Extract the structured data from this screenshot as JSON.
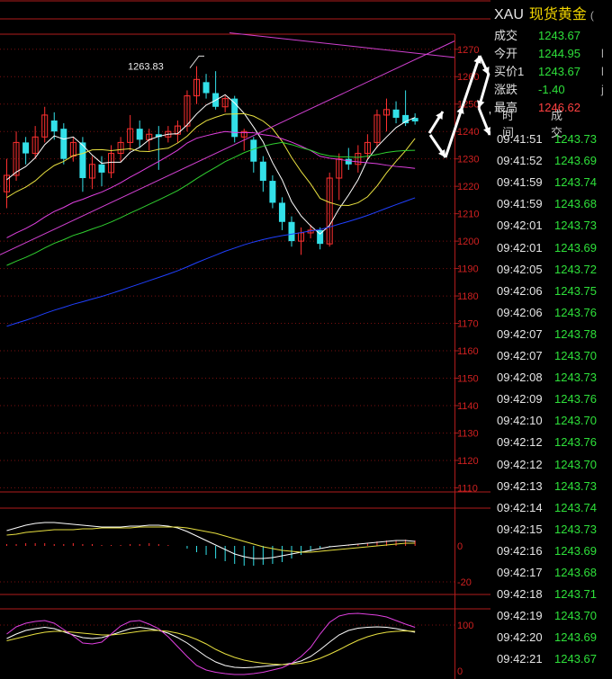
{
  "header": {
    "symbol": "XAU",
    "name": "现货黄金",
    "extra": "("
  },
  "quote": [
    {
      "label": "成交",
      "value": "1243.67",
      "color": "#2ee03a",
      "extra": ""
    },
    {
      "label": "今开",
      "value": "1244.95",
      "color": "#2ee03a",
      "extra": "l"
    },
    {
      "label": "买价1",
      "value": "1243.67",
      "color": "#2ee03a",
      "extra": "l"
    },
    {
      "label": "涨跌",
      "value": "-1.40",
      "color": "#2ee03a",
      "extra": "j"
    },
    {
      "label": "最高",
      "value": "1246.62",
      "color": "#ff4040",
      "extra": ""
    }
  ],
  "ticks_header": {
    "time": "时间",
    "trade": "成交"
  },
  "ticks": [
    {
      "time": "09:41:51",
      "price": "1243.73"
    },
    {
      "time": "09:41:52",
      "price": "1243.69"
    },
    {
      "time": "09:41:59",
      "price": "1243.74"
    },
    {
      "time": "09:41:59",
      "price": "1243.68"
    },
    {
      "time": "09:42:01",
      "price": "1243.73"
    },
    {
      "time": "09:42:01",
      "price": "1243.69"
    },
    {
      "time": "09:42:05",
      "price": "1243.72"
    },
    {
      "time": "09:42:06",
      "price": "1243.75"
    },
    {
      "time": "09:42:06",
      "price": "1243.76"
    },
    {
      "time": "09:42:07",
      "price": "1243.78"
    },
    {
      "time": "09:42:07",
      "price": "1243.70"
    },
    {
      "time": "09:42:08",
      "price": "1243.73"
    },
    {
      "time": "09:42:09",
      "price": "1243.76"
    },
    {
      "time": "09:42:10",
      "price": "1243.70"
    },
    {
      "time": "09:42:12",
      "price": "1243.76"
    },
    {
      "time": "09:42:12",
      "price": "1243.70"
    },
    {
      "time": "09:42:13",
      "price": "1243.73"
    },
    {
      "time": "09:42:14",
      "price": "1243.74"
    },
    {
      "time": "09:42:15",
      "price": "1243.73"
    },
    {
      "time": "09:42:16",
      "price": "1243.69"
    },
    {
      "time": "09:42:17",
      "price": "1243.68"
    },
    {
      "time": "09:42:18",
      "price": "1243.71"
    },
    {
      "time": "09:42:19",
      "price": "1243.70"
    },
    {
      "time": "09:42:20",
      "price": "1243.69"
    },
    {
      "time": "09:42:21",
      "price": "1243.67"
    }
  ],
  "chart_data": {
    "type": "candlestick",
    "high_annotation": "1263.83",
    "price_axis": {
      "ticks": [
        1270,
        1260,
        1250,
        1240,
        1230,
        1220,
        1210,
        1200,
        1190,
        1180,
        1170,
        1160,
        1150,
        1140,
        1130,
        1120,
        1110
      ],
      "range": [
        1108,
        1275
      ]
    },
    "macd_axis": {
      "ticks": [
        0,
        -20
      ]
    },
    "kdj_axis": {
      "ticks": [
        100,
        0
      ]
    },
    "candles": [
      {
        "o": 1218,
        "c": 1224,
        "h": 1230,
        "l": 1212
      },
      {
        "o": 1224,
        "c": 1236,
        "h": 1240,
        "l": 1222
      },
      {
        "o": 1236,
        "c": 1232,
        "h": 1238,
        "l": 1228
      },
      {
        "o": 1232,
        "c": 1238,
        "h": 1242,
        "l": 1230
      },
      {
        "o": 1238,
        "c": 1246,
        "h": 1249,
        "l": 1236
      },
      {
        "o": 1244,
        "c": 1240,
        "h": 1247,
        "l": 1237
      },
      {
        "o": 1241,
        "c": 1230,
        "h": 1243,
        "l": 1228
      },
      {
        "o": 1231,
        "c": 1236,
        "h": 1238,
        "l": 1229
      },
      {
        "o": 1236,
        "c": 1223,
        "h": 1238,
        "l": 1218
      },
      {
        "o": 1223,
        "c": 1228,
        "h": 1231,
        "l": 1219
      },
      {
        "o": 1228,
        "c": 1225,
        "h": 1231,
        "l": 1220
      },
      {
        "o": 1225,
        "c": 1232,
        "h": 1235,
        "l": 1223
      },
      {
        "o": 1232,
        "c": 1236,
        "h": 1238,
        "l": 1229
      },
      {
        "o": 1236,
        "c": 1241,
        "h": 1246,
        "l": 1233
      },
      {
        "o": 1241,
        "c": 1237,
        "h": 1244,
        "l": 1234
      },
      {
        "o": 1237,
        "c": 1239,
        "h": 1241,
        "l": 1233
      },
      {
        "o": 1239,
        "c": 1238,
        "h": 1242,
        "l": 1226
      },
      {
        "o": 1238,
        "c": 1240,
        "h": 1242,
        "l": 1236
      },
      {
        "o": 1239,
        "c": 1242,
        "h": 1244,
        "l": 1236
      },
      {
        "o": 1242,
        "c": 1253,
        "h": 1255,
        "l": 1240
      },
      {
        "o": 1253,
        "c": 1259,
        "h": 1263.83,
        "l": 1250
      },
      {
        "o": 1258,
        "c": 1254,
        "h": 1261,
        "l": 1252
      },
      {
        "o": 1254,
        "c": 1249,
        "h": 1262,
        "l": 1248
      },
      {
        "o": 1249,
        "c": 1252,
        "h": 1253,
        "l": 1247
      },
      {
        "o": 1252,
        "c": 1238,
        "h": 1253,
        "l": 1236
      },
      {
        "o": 1238,
        "c": 1240,
        "h": 1241,
        "l": 1233
      },
      {
        "o": 1237,
        "c": 1229,
        "h": 1238,
        "l": 1225
      },
      {
        "o": 1229,
        "c": 1222,
        "h": 1231,
        "l": 1218
      },
      {
        "o": 1222,
        "c": 1214,
        "h": 1224,
        "l": 1212
      },
      {
        "o": 1214,
        "c": 1207,
        "h": 1216,
        "l": 1204
      },
      {
        "o": 1207,
        "c": 1200,
        "h": 1209,
        "l": 1198
      },
      {
        "o": 1200,
        "c": 1203,
        "h": 1205,
        "l": 1195
      },
      {
        "o": 1203,
        "c": 1204,
        "h": 1206,
        "l": 1201
      },
      {
        "o": 1204,
        "c": 1199,
        "h": 1205,
        "l": 1197
      },
      {
        "o": 1199,
        "c": 1223,
        "h": 1225,
        "l": 1198
      },
      {
        "o": 1223,
        "c": 1230,
        "h": 1232,
        "l": 1215
      },
      {
        "o": 1230,
        "c": 1228,
        "h": 1234,
        "l": 1226
      },
      {
        "o": 1228,
        "c": 1232,
        "h": 1235,
        "l": 1225
      },
      {
        "o": 1232,
        "c": 1236,
        "h": 1239,
        "l": 1230
      },
      {
        "o": 1236,
        "c": 1246,
        "h": 1248,
        "l": 1234
      },
      {
        "o": 1246,
        "c": 1248,
        "h": 1252,
        "l": 1240
      },
      {
        "o": 1248,
        "c": 1245,
        "h": 1251,
        "l": 1243
      },
      {
        "o": 1246,
        "c": 1243,
        "h": 1255,
        "l": 1242
      },
      {
        "o": 1244.95,
        "c": 1243.67,
        "h": 1246.62,
        "l": 1242.5
      }
    ],
    "colors": {
      "up": "#ff3030",
      "down": "#33e0e8",
      "ma5": "#ffffff",
      "ma10": "#e8e040",
      "ma20": "#e040e0",
      "ma30": "#30d030",
      "ma60": "#2040ff",
      "trend": "#d040d0"
    }
  }
}
